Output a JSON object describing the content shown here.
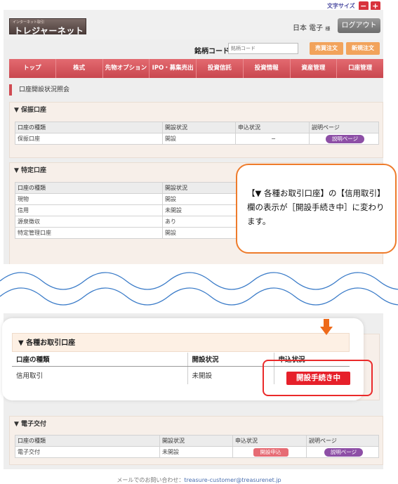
{
  "font_size": {
    "label": "文字サイズ",
    "decrease": "−",
    "increase": "+"
  },
  "header": {
    "logo_small": "インターネット取引",
    "logo_main": "トレジャーネット",
    "user_name": "日本 電子",
    "user_suffix": "様",
    "logout": "ログアウト"
  },
  "stock_code": {
    "label": "銘柄コード",
    "placeholder": "銘柄コード",
    "buy_sell": "売買注文",
    "new_order": "新規注文"
  },
  "nav": [
    "トップ",
    "株式",
    "先物オプション",
    "IPO・募集売出",
    "投資信託",
    "投資情報",
    "資産管理",
    "口座管理"
  ],
  "page_title": "口座開設状況照会",
  "hofuri": {
    "title": "▼ 保振口座",
    "headers": [
      "口座の種類",
      "開設状況",
      "申込状況",
      "説明ページ"
    ],
    "row": {
      "type": "保振口座",
      "status": "開設",
      "apply": "−",
      "button": "説明ページ"
    }
  },
  "tokutei": {
    "title": "▼ 特定口座",
    "headers": [
      "口座の種類",
      "開設状況"
    ],
    "rows": [
      {
        "type": "現物",
        "status": "開設"
      },
      {
        "type": "信用",
        "status": "未開設"
      },
      {
        "type": "源泉徴収",
        "status": "あり"
      },
      {
        "type": "特定管理口座",
        "status": "開設"
      }
    ]
  },
  "callout": {
    "text": "【▼ 各種お取引口座】の【信用取引】欄の表示が［開設手続き中］に変わります。"
  },
  "zoom": {
    "title": "▼ 各種お取引口座",
    "headers": [
      "口座の種類",
      "開設状況",
      "申込状況"
    ],
    "row": {
      "type": "信用取引",
      "status": "未開設",
      "badge": "開設手続き中"
    }
  },
  "denshi": {
    "title": "▼ 電子交付",
    "headers": [
      "口座の種類",
      "開設状況",
      "申込状況",
      "説明ページ"
    ],
    "row": {
      "type": "電子交付",
      "status": "未開設",
      "apply_button": "開設申込",
      "button": "説明ページ"
    }
  },
  "footer": {
    "text": "メールでのお問い合わせ：",
    "email": "treasure-customer@treasurenet.jp"
  },
  "colors": {
    "accent_red": "#e6202a",
    "nav_red": "#d04a52",
    "callout_orange": "#ee7b2b",
    "wave_blue": "#3a7bc8",
    "pill_purple": "#8d4fa6"
  }
}
